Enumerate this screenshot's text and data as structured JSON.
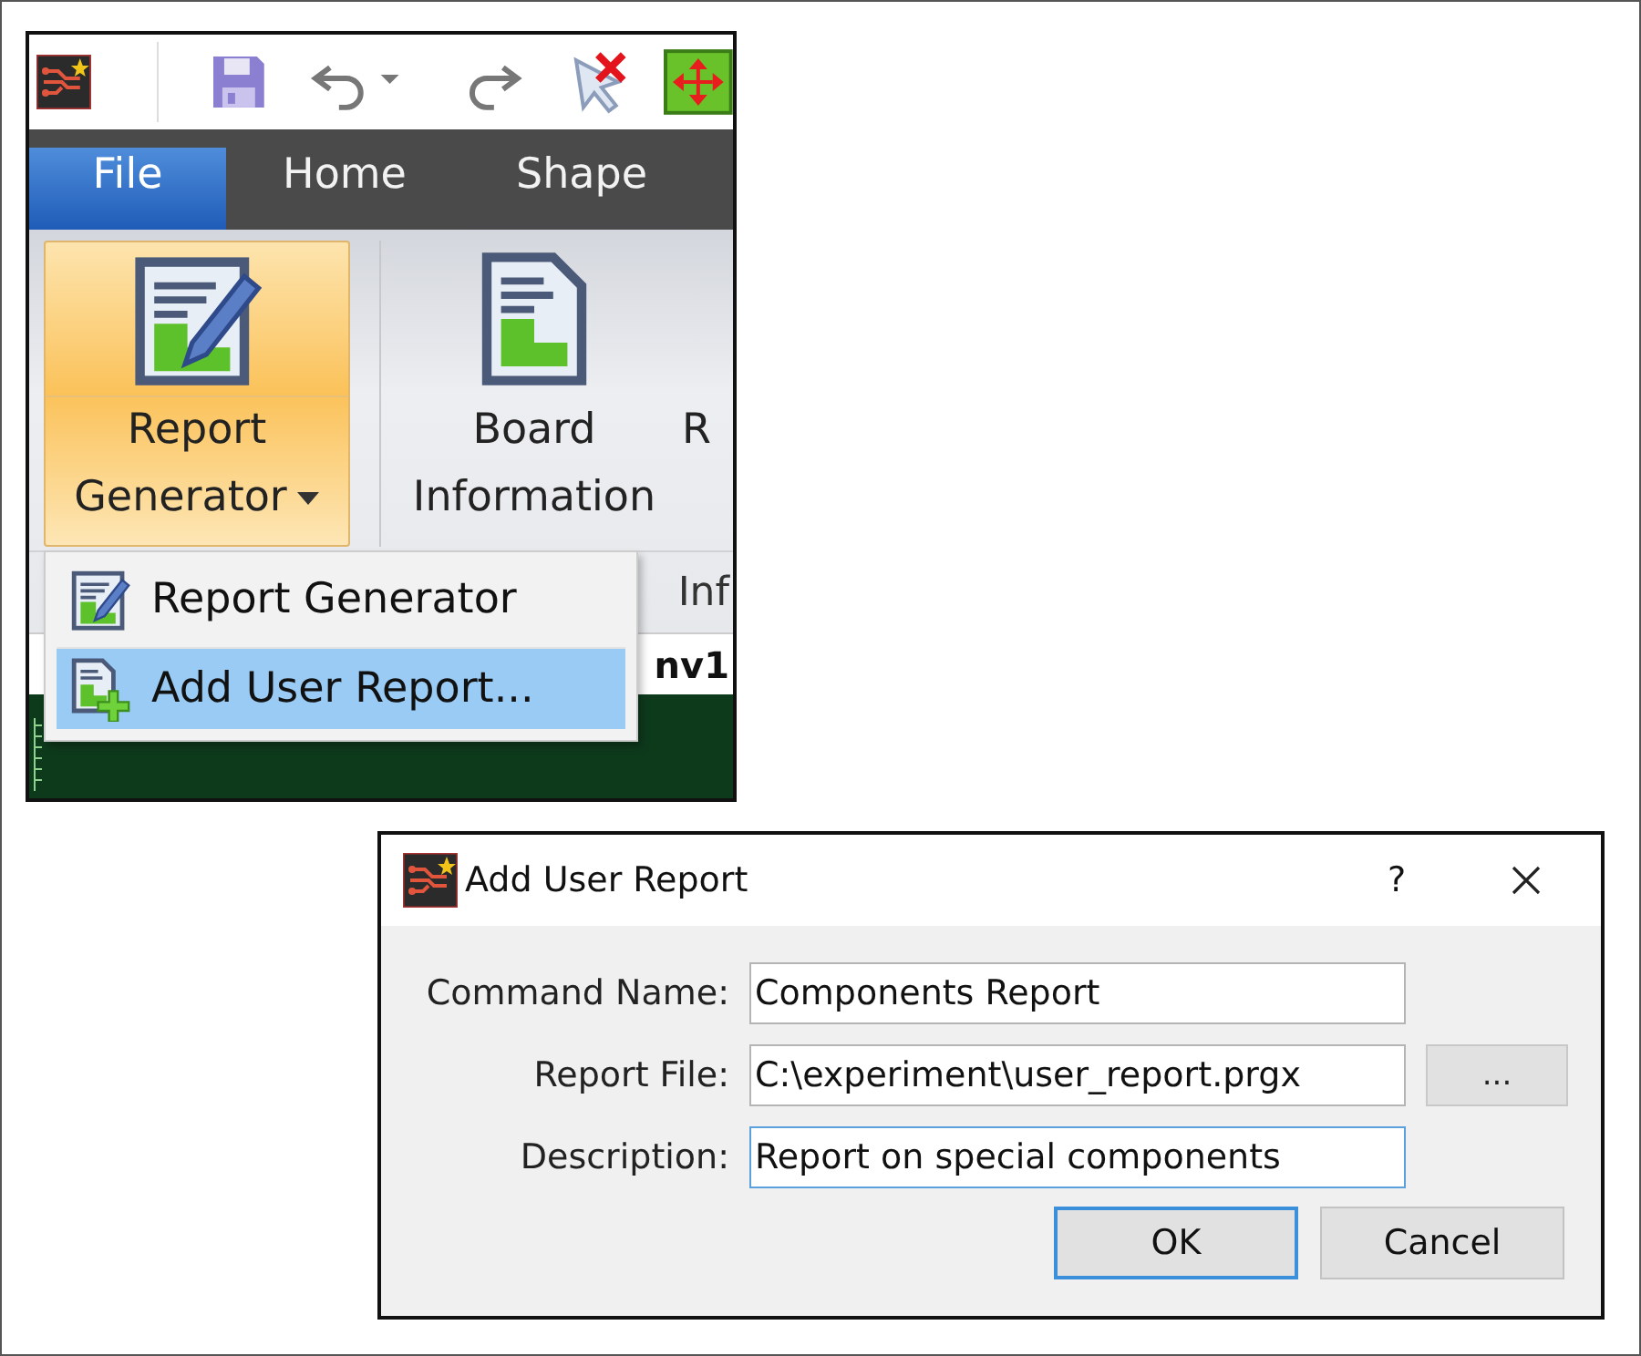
{
  "app_window": {
    "tabs": [
      {
        "label": "File",
        "selected": true
      },
      {
        "label": "Home",
        "selected": false
      },
      {
        "label": "Shape",
        "selected": false
      }
    ],
    "ribbon_buttons": [
      {
        "kind": "edit",
        "label": "Report Generator",
        "dropdown": true,
        "highlighted": true
      },
      {
        "kind": "document",
        "label": "Board Information",
        "dropdown": false,
        "highlighted": false
      },
      {
        "kind": "none",
        "label": "R",
        "dropdown": false,
        "highlighted": false
      }
    ],
    "group_label": "Inf",
    "document_tab": "nv1",
    "menu": {
      "items": [
        {
          "kind": "edit",
          "label": "Report Generator",
          "selected": false
        },
        {
          "kind": "add",
          "label": "Add User Report...",
          "selected": true
        }
      ]
    }
  },
  "dialog": {
    "title": "Add User Report",
    "help": "?",
    "fields": [
      {
        "label": "Command Name:",
        "value": "Components Report",
        "focused": false,
        "browse": false
      },
      {
        "label": "Report File:",
        "value": "C:\\experiment\\user_report.prgx",
        "focused": false,
        "browse": true,
        "browse_label": "..."
      },
      {
        "label": "Description:",
        "value": "Report on special components",
        "focused": true,
        "browse": false
      }
    ],
    "buttons": [
      {
        "label": "OK",
        "default": true
      },
      {
        "label": "Cancel",
        "default": false
      }
    ]
  }
}
